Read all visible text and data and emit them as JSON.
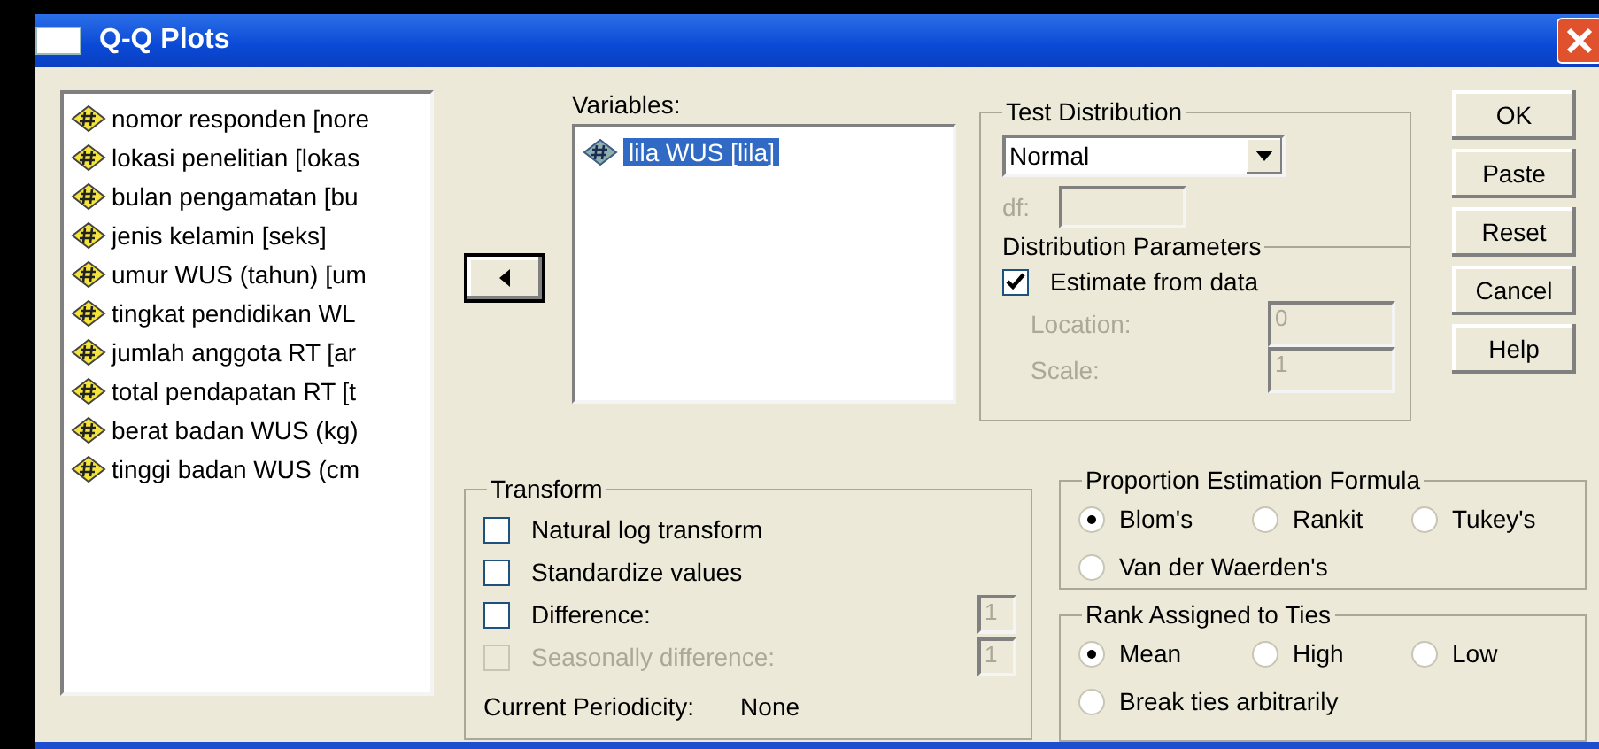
{
  "window": {
    "title": "Q-Q Plots"
  },
  "source_variables": [
    {
      "label": "nomor responden [nore"
    },
    {
      "label": "lokasi penelitian [lokas"
    },
    {
      "label": "bulan pengamatan [bu"
    },
    {
      "label": "jenis kelamin [seks]"
    },
    {
      "label": "umur WUS (tahun) [um"
    },
    {
      "label": "tingkat pendidikan WL"
    },
    {
      "label": "jumlah anggota RT [ar"
    },
    {
      "label": "total pendapatan RT [t"
    },
    {
      "label": "berat badan WUS (kg)"
    },
    {
      "label": "tinggi badan WUS (cm"
    }
  ],
  "variables": {
    "label": "Variables:",
    "items": [
      {
        "label": "lila WUS [lila]",
        "selected": true
      }
    ]
  },
  "test_distribution": {
    "title": "Test Distribution",
    "value": "Normal",
    "df_label": "df:",
    "df_disabled": true,
    "parameters_title": "Distribution Parameters",
    "estimate": {
      "label": "Estimate from data",
      "checked": true
    },
    "fields": [
      {
        "label": "Location:",
        "value": "0",
        "disabled": true
      },
      {
        "label": "Scale:",
        "value": "1",
        "disabled": true
      }
    ]
  },
  "transform": {
    "title": "Transform",
    "options": [
      {
        "label": "Natural log transform",
        "checked": false,
        "disabled": false
      },
      {
        "label": "Standardize values",
        "checked": false,
        "disabled": false
      },
      {
        "label": "Difference:",
        "checked": false,
        "disabled": false,
        "value": "1"
      },
      {
        "label": "Seasonally difference:",
        "checked": false,
        "disabled": true,
        "value": "1"
      }
    ],
    "periodicity_label": "Current Periodicity:",
    "periodicity_value": "None"
  },
  "proportion": {
    "title": "Proportion Estimation Formula",
    "options": [
      {
        "label": "Blom's",
        "selected": true
      },
      {
        "label": "Rankit",
        "selected": false
      },
      {
        "label": "Tukey's",
        "selected": false
      },
      {
        "label": "Van der Waerden's",
        "selected": false
      }
    ]
  },
  "ties": {
    "title": "Rank Assigned to Ties",
    "options": [
      {
        "label": "Mean",
        "selected": true
      },
      {
        "label": "High",
        "selected": false
      },
      {
        "label": "Low",
        "selected": false
      },
      {
        "label": "Break ties arbitrarily",
        "selected": false
      }
    ]
  },
  "buttons": [
    {
      "label": "OK"
    },
    {
      "label": "Paste"
    },
    {
      "label": "Reset"
    },
    {
      "label": "Cancel"
    },
    {
      "label": "Help"
    }
  ]
}
